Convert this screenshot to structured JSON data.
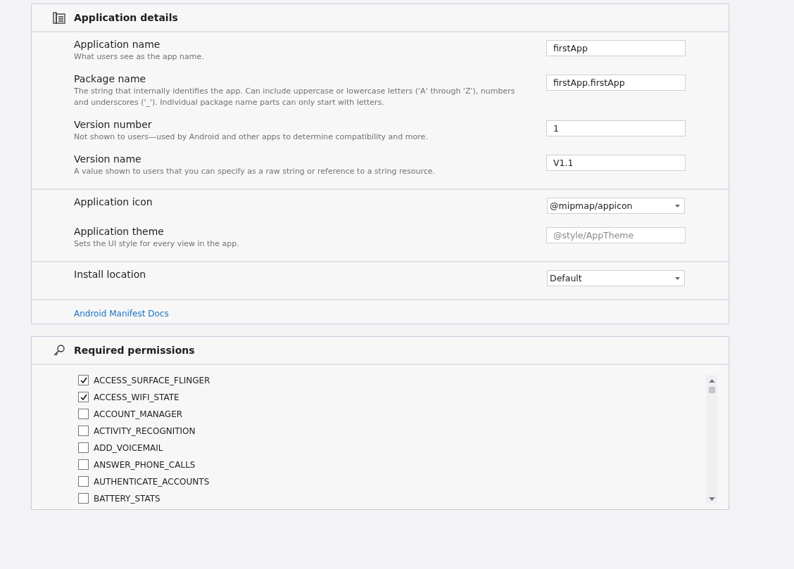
{
  "application_details": {
    "title": "Application details",
    "groups": [
      {
        "rows": [
          {
            "kind": "text",
            "label": "Application name",
            "description": "What users see as the app name.",
            "value": "firstApp"
          },
          {
            "kind": "text",
            "label": "Package name",
            "description": "The string that internally identifies the app. Can include uppercase or lowercase letters ('A' through 'Z'), numbers and underscores ('_'). Individual package name parts can only start with letters.",
            "value": "firstApp.firstApp"
          },
          {
            "kind": "text",
            "label": "Version number",
            "description": "Not shown to users—used by Android and other apps to determine compatibility and more.",
            "value": "1"
          },
          {
            "kind": "text",
            "label": "Version name",
            "description": "A value shown to users that you can specify as a raw string or reference to a string resource.",
            "value": "V1.1"
          }
        ]
      },
      {
        "rows": [
          {
            "kind": "dropdown",
            "label": "Application icon",
            "value": "@mipmap/appicon"
          },
          {
            "kind": "text",
            "label": "Application theme",
            "description": "Sets the UI style for every view in the app.",
            "placeholder": "@style/AppTheme"
          }
        ]
      },
      {
        "rows": [
          {
            "kind": "dropdown",
            "label": "Install location",
            "value": "Default"
          }
        ]
      }
    ],
    "link": "Android Manifest Docs"
  },
  "required_permissions": {
    "title": "Required permissions",
    "items": [
      {
        "label": "ACCESS_SURFACE_FLINGER",
        "checked": true
      },
      {
        "label": "ACCESS_WIFI_STATE",
        "checked": true
      },
      {
        "label": "ACCOUNT_MANAGER",
        "checked": false
      },
      {
        "label": "ACTIVITY_RECOGNITION",
        "checked": false
      },
      {
        "label": "ADD_VOICEMAIL",
        "checked": false
      },
      {
        "label": "ANSWER_PHONE_CALLS",
        "checked": false
      },
      {
        "label": "AUTHENTICATE_ACCOUNTS",
        "checked": false
      },
      {
        "label": "BATTERY_STATS",
        "checked": false
      }
    ]
  }
}
